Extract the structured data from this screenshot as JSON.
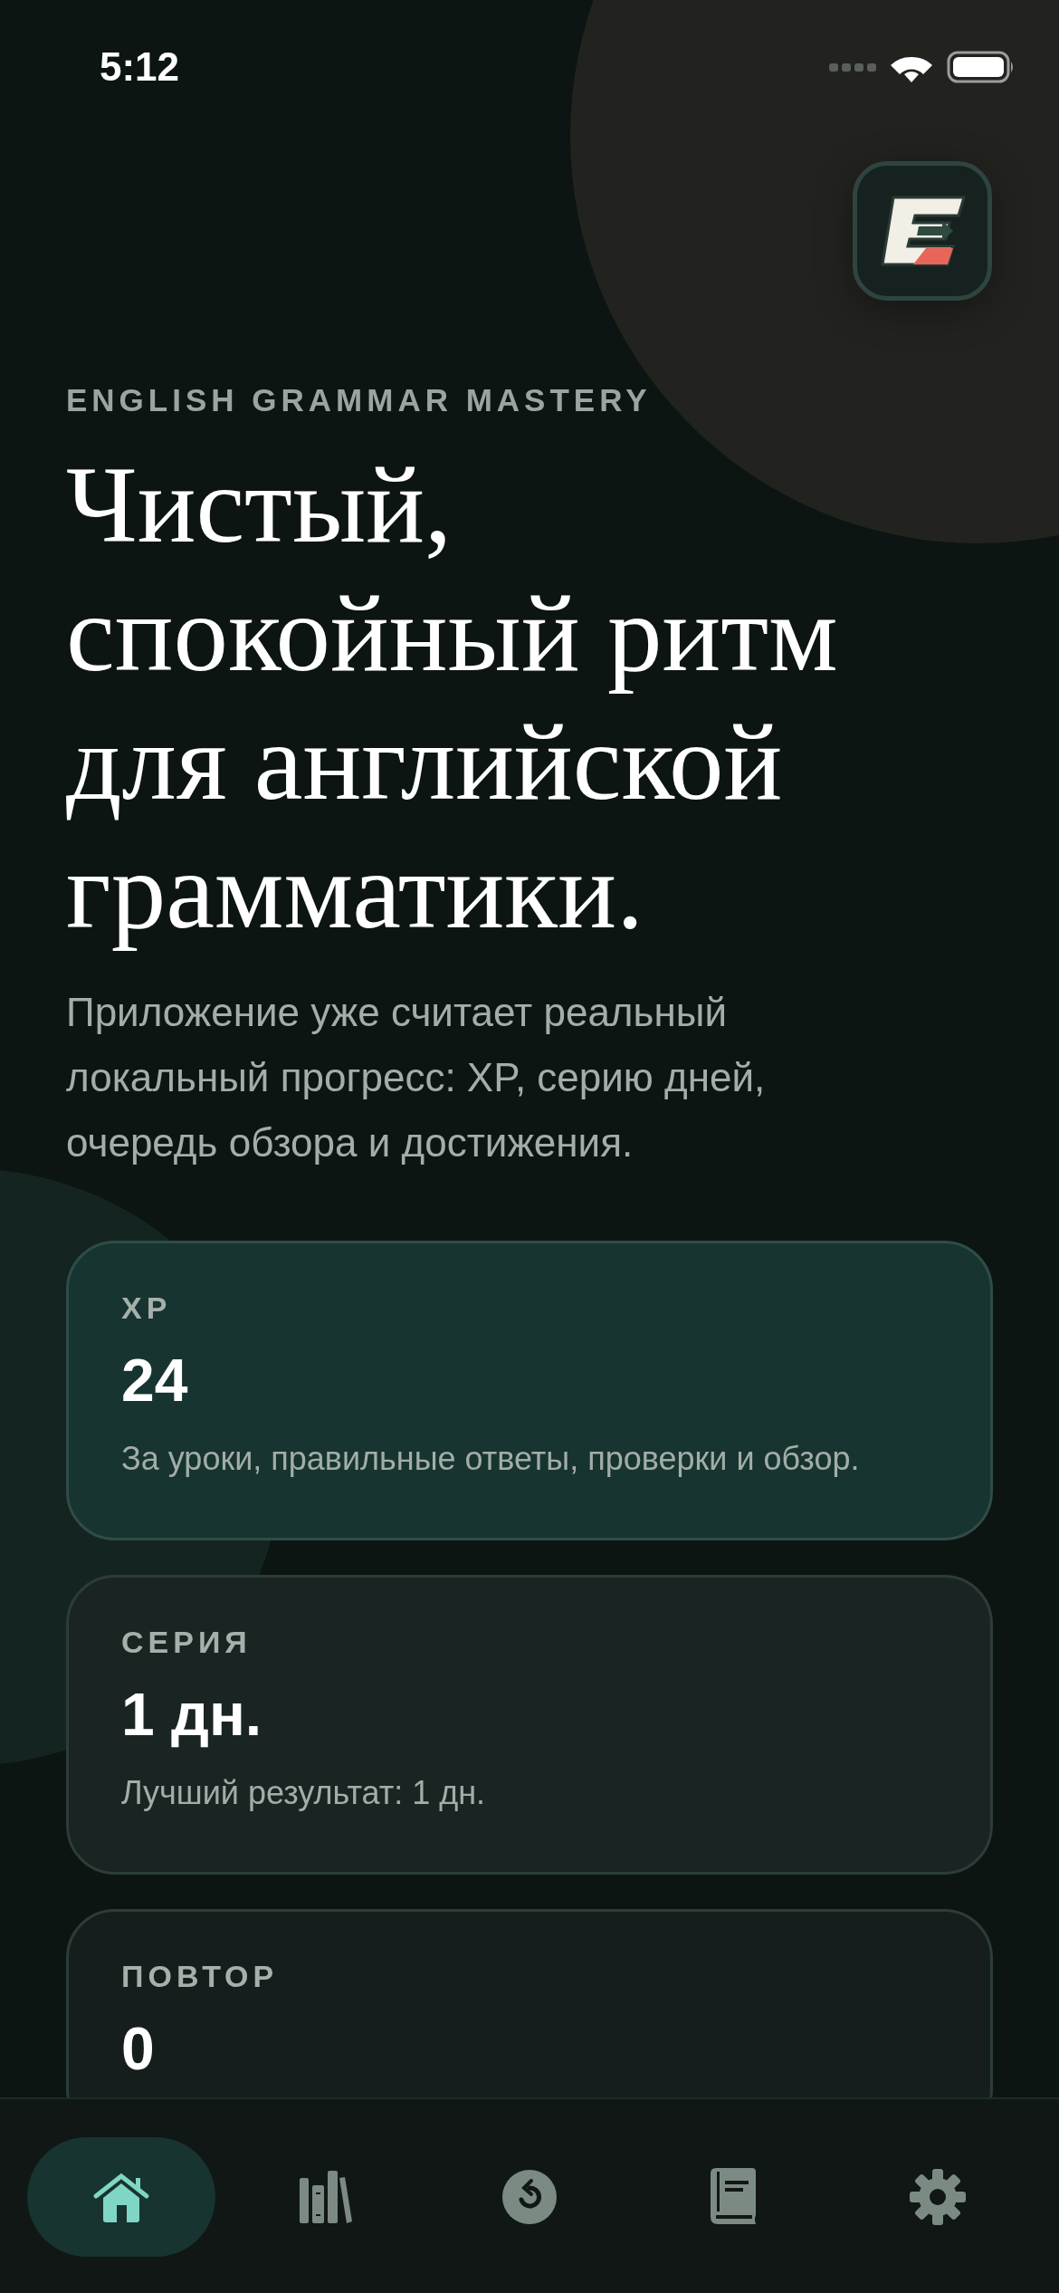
{
  "status_bar": {
    "time": "5:12"
  },
  "eyebrow": "ENGLISH GRAMMAR MASTERY",
  "headline": "Чистый, спокойный ритм для английской грамматики.",
  "intro": "Приложение уже считает реальный локальный прогресс: XP, серию дней, очередь обзора и достижения.",
  "cards": [
    {
      "kind": "accent",
      "label": "XP",
      "value": "24",
      "note": "За уроки, правильные ответы, проверки и обзор."
    },
    {
      "kind": "plain",
      "label": "СЕРИЯ",
      "value": "1 дн.",
      "note": "Лучший результат: 1 дн."
    },
    {
      "kind": "muted",
      "label": "ПОВТОР",
      "value": "0"
    }
  ],
  "tabs": [
    {
      "kind": "home",
      "selected": true
    },
    {
      "kind": "library",
      "selected": false
    },
    {
      "kind": "review",
      "selected": false
    },
    {
      "kind": "book",
      "selected": false
    },
    {
      "kind": "settings",
      "selected": false
    }
  ]
}
